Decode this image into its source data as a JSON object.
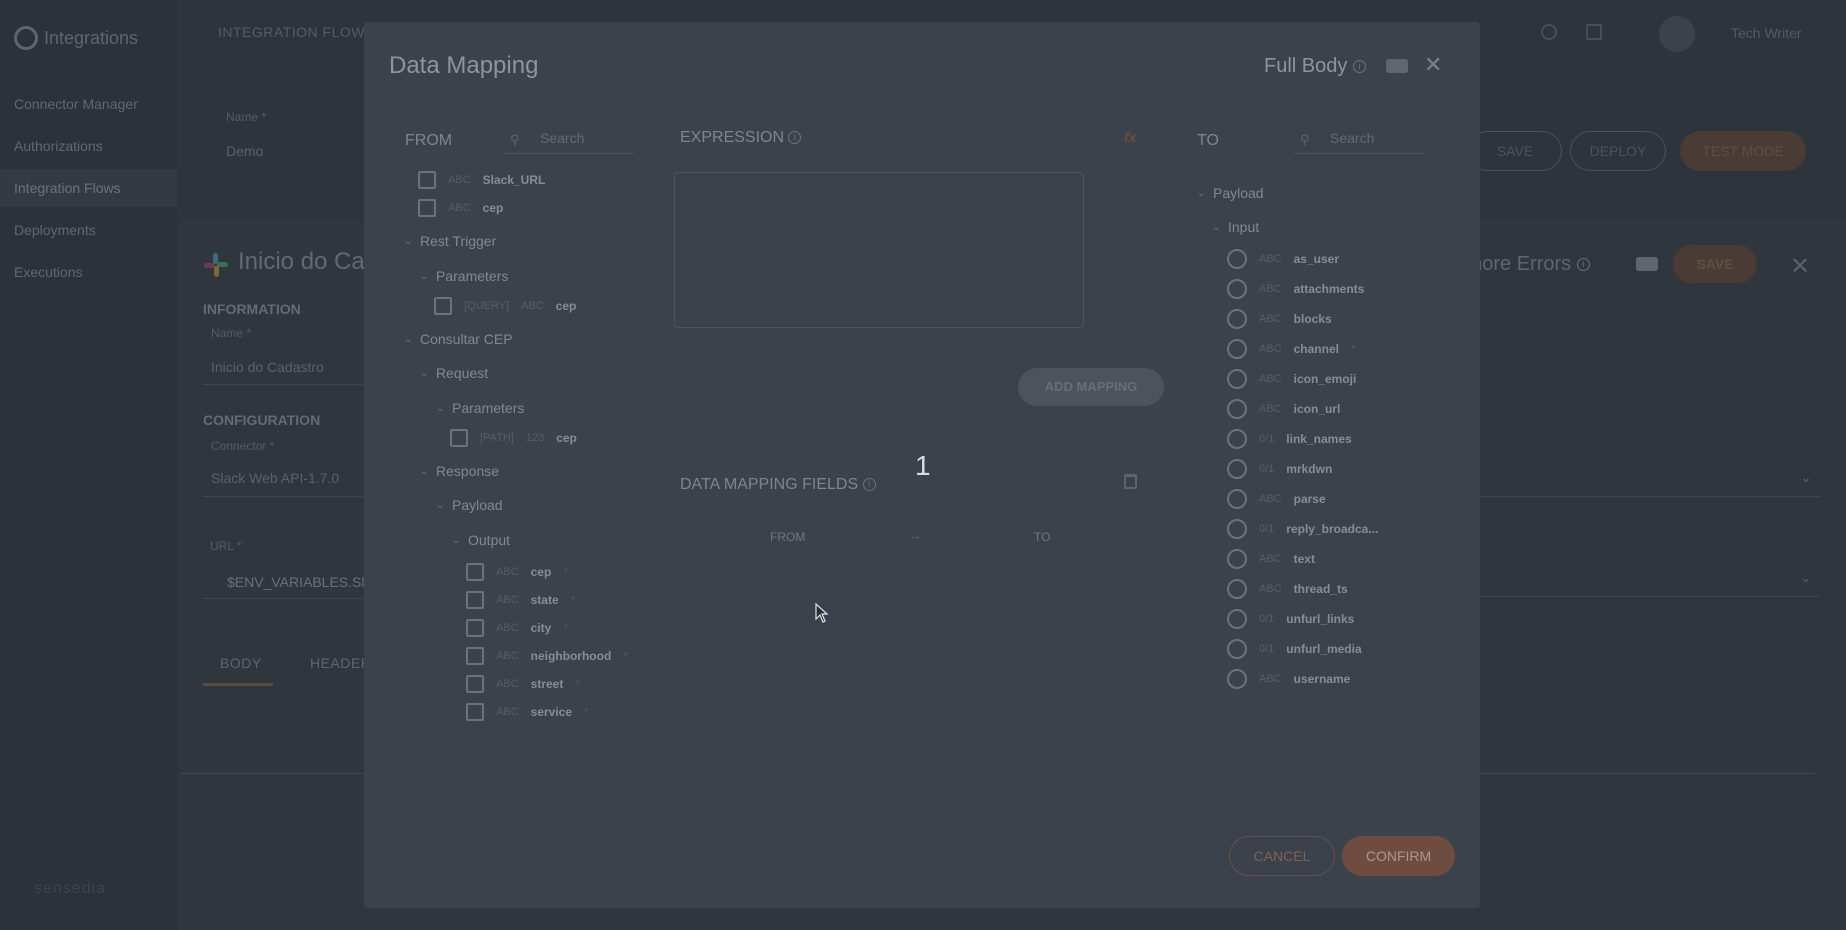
{
  "sidebar": {
    "logo_text": "Integrations",
    "items": [
      {
        "label": "Connector Manager"
      },
      {
        "label": "Authorizations"
      },
      {
        "label": "Integration Flows"
      },
      {
        "label": "Deployments"
      },
      {
        "label": "Executions"
      }
    ],
    "brand": "sensedia"
  },
  "background": {
    "top_title": "INTEGRATION FLOWS",
    "name_label": "Name *",
    "name_value": "Demo",
    "save_label": "SAVE",
    "deploy_label": "DEPLOY",
    "test_label": "TEST MODE",
    "user_name": "Tech Writer",
    "panel_title": "Inicio do Ca",
    "information_label": "INFORMATION",
    "panel_name_label": "Name *",
    "panel_name_value": "Inicio do Cadastro",
    "configuration_label": "CONFIGURATION",
    "connector_label": "Connector *",
    "connector_value": "Slack Web API-1.7.0",
    "url_label": "URL *",
    "url_value": "$ENV_VARIABLES.Sla",
    "tab_body": "BODY",
    "tab_headers": "HEADER",
    "ignore_errors": "gnore Errors",
    "panel_save": "SAVE"
  },
  "modal": {
    "title": "Data Mapping",
    "full_body_label": "Full Body",
    "from_label": "FROM",
    "to_label": "TO",
    "search_placeholder": "Search",
    "expression_label": "EXPRESSION",
    "fx_label": "fx",
    "add_mapping_label": "ADD MAPPING",
    "data_mapping_fields_label": "DATA MAPPING FIELDS",
    "dm_from": "FROM",
    "dm_to": "TO",
    "overlay_number": "1",
    "cancel_label": "CANCEL",
    "confirm_label": "CONFIRM",
    "from_tree": {
      "env_fields": [
        {
          "type": "ABC",
          "name": "Slack_URL"
        },
        {
          "type": "ABC",
          "name": "cep"
        }
      ],
      "rest_trigger": "Rest Trigger",
      "parameters": "Parameters",
      "rest_param": {
        "prefix": "[QUERY]",
        "type": "ABC",
        "name": "cep"
      },
      "consultar_cep": "Consultar CEP",
      "request": "Request",
      "request_parameters": "Parameters",
      "request_param": {
        "prefix": "[PATH]",
        "type": "123",
        "name": "cep"
      },
      "response": "Response",
      "payload": "Payload",
      "output": "Output",
      "output_fields": [
        {
          "type": "ABC",
          "name": "cep",
          "req": "*"
        },
        {
          "type": "ABC",
          "name": "state",
          "req": "*"
        },
        {
          "type": "ABC",
          "name": "city",
          "req": "*"
        },
        {
          "type": "ABC",
          "name": "neighborhood",
          "req": "*"
        },
        {
          "type": "ABC",
          "name": "street",
          "req": "*"
        },
        {
          "type": "ABC",
          "name": "service",
          "req": "*"
        }
      ]
    },
    "to_tree": {
      "payload": "Payload",
      "input": "Input",
      "fields": [
        {
          "type": "ABC",
          "name": "as_user",
          "req": ""
        },
        {
          "type": "ABC",
          "name": "attachments",
          "req": ""
        },
        {
          "type": "ABC",
          "name": "blocks",
          "req": ""
        },
        {
          "type": "ABC",
          "name": "channel",
          "req": "*"
        },
        {
          "type": "ABC",
          "name": "icon_emoji",
          "req": ""
        },
        {
          "type": "ABC",
          "name": "icon_url",
          "req": ""
        },
        {
          "type": "0/1",
          "name": "link_names",
          "req": ""
        },
        {
          "type": "0/1",
          "name": "mrkdwn",
          "req": ""
        },
        {
          "type": "ABC",
          "name": "parse",
          "req": ""
        },
        {
          "type": "0/1",
          "name": "reply_broadca...",
          "req": ""
        },
        {
          "type": "ABC",
          "name": "text",
          "req": ""
        },
        {
          "type": "ABC",
          "name": "thread_ts",
          "req": ""
        },
        {
          "type": "0/1",
          "name": "unfurl_links",
          "req": ""
        },
        {
          "type": "0/1",
          "name": "unfurl_media",
          "req": ""
        },
        {
          "type": "ABC",
          "name": "username",
          "req": ""
        }
      ]
    }
  }
}
